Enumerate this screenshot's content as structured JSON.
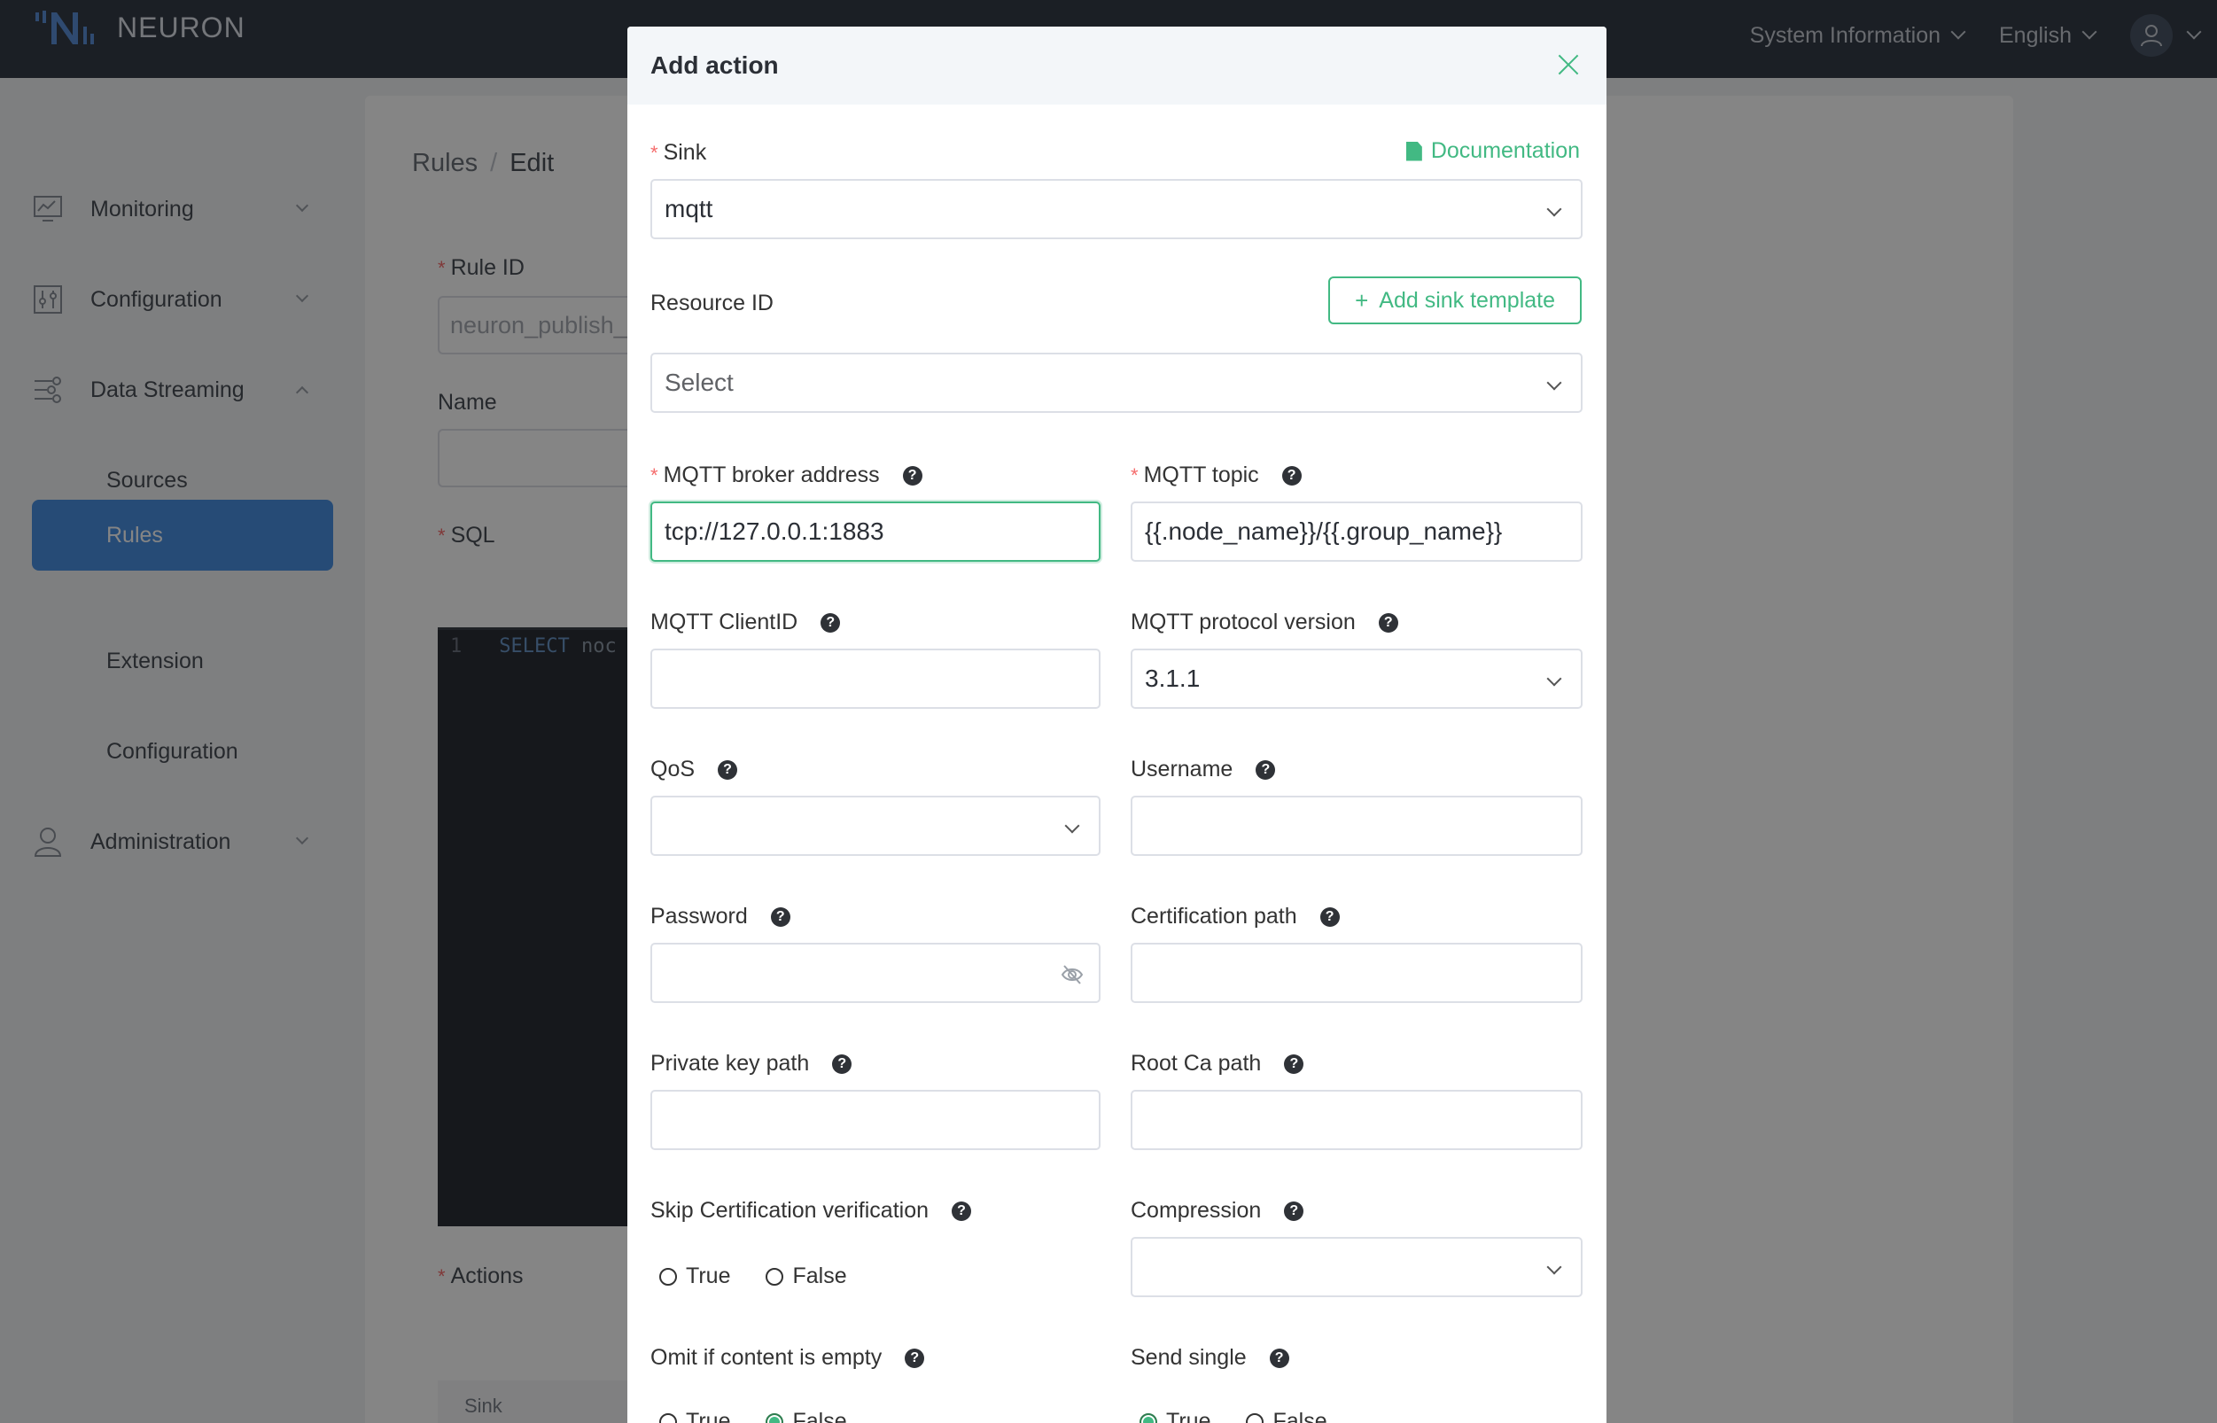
{
  "app": {
    "brand": "NEURON",
    "top_menu": [
      {
        "label": "System Information"
      },
      {
        "label": "English"
      }
    ]
  },
  "sidebar": {
    "items": [
      {
        "label": "Monitoring",
        "icon": "monitor-chart-icon",
        "expanded": false
      },
      {
        "label": "Configuration",
        "icon": "sliders-icon",
        "expanded": false
      },
      {
        "label": "Data Streaming",
        "icon": "data-stream-icon",
        "expanded": true
      },
      {
        "label": "Administration",
        "icon": "user-icon",
        "expanded": false
      }
    ],
    "sub_items": [
      {
        "label": "Sources",
        "active": false
      },
      {
        "label": "Rules",
        "active": true
      },
      {
        "label": "Extension",
        "active": false
      },
      {
        "label": "Configuration",
        "active": false
      }
    ]
  },
  "page": {
    "breadcrumb": [
      "Rules",
      "Edit"
    ],
    "rule_id_label": "Rule ID",
    "rule_id_value": "neuron_publish_",
    "name_label": "Name",
    "sql_label": "SQL",
    "sql_line_no": "1",
    "sql_keyword": "SELECT",
    "sql_rest": "noc",
    "actions_label": "Actions",
    "table_head": "Sink"
  },
  "modal": {
    "title": "Add action",
    "documentation_link": "Documentation",
    "add_sink_template": "Add sink template",
    "fields": {
      "sink": {
        "label": "Sink",
        "required": true,
        "value": "mqtt"
      },
      "resource_id": {
        "label": "Resource ID",
        "placeholder": "Select"
      },
      "broker": {
        "label": "MQTT broker address",
        "required": true,
        "value": "tcp://127.0.0.1:1883"
      },
      "topic": {
        "label": "MQTT topic",
        "required": true,
        "value": "{{.node_name}}/{{.group_name}}"
      },
      "client_id": {
        "label": "MQTT ClientID",
        "value": ""
      },
      "protocol": {
        "label": "MQTT protocol version",
        "value": "3.1.1"
      },
      "qos": {
        "label": "QoS",
        "value": ""
      },
      "username": {
        "label": "Username",
        "value": ""
      },
      "password": {
        "label": "Password",
        "value": ""
      },
      "cert_path": {
        "label": "Certification path",
        "value": ""
      },
      "private_key": {
        "label": "Private key path",
        "value": ""
      },
      "root_ca": {
        "label": "Root Ca path",
        "value": ""
      },
      "skip_verify": {
        "label": "Skip Certification verification",
        "options": [
          "True",
          "False"
        ],
        "selected": null
      },
      "compression": {
        "label": "Compression",
        "value": ""
      },
      "omit_empty": {
        "label": "Omit if content is empty",
        "options": [
          "True",
          "False"
        ],
        "selected": "False"
      },
      "send_single": {
        "label": "Send single",
        "options": [
          "True",
          "False"
        ],
        "selected": "True"
      }
    },
    "help_glyph": "?"
  },
  "colors": {
    "accent": "#42b983",
    "active_nav": "#4a90e2",
    "topbar": "#343c48",
    "required": "#f56c6c"
  }
}
